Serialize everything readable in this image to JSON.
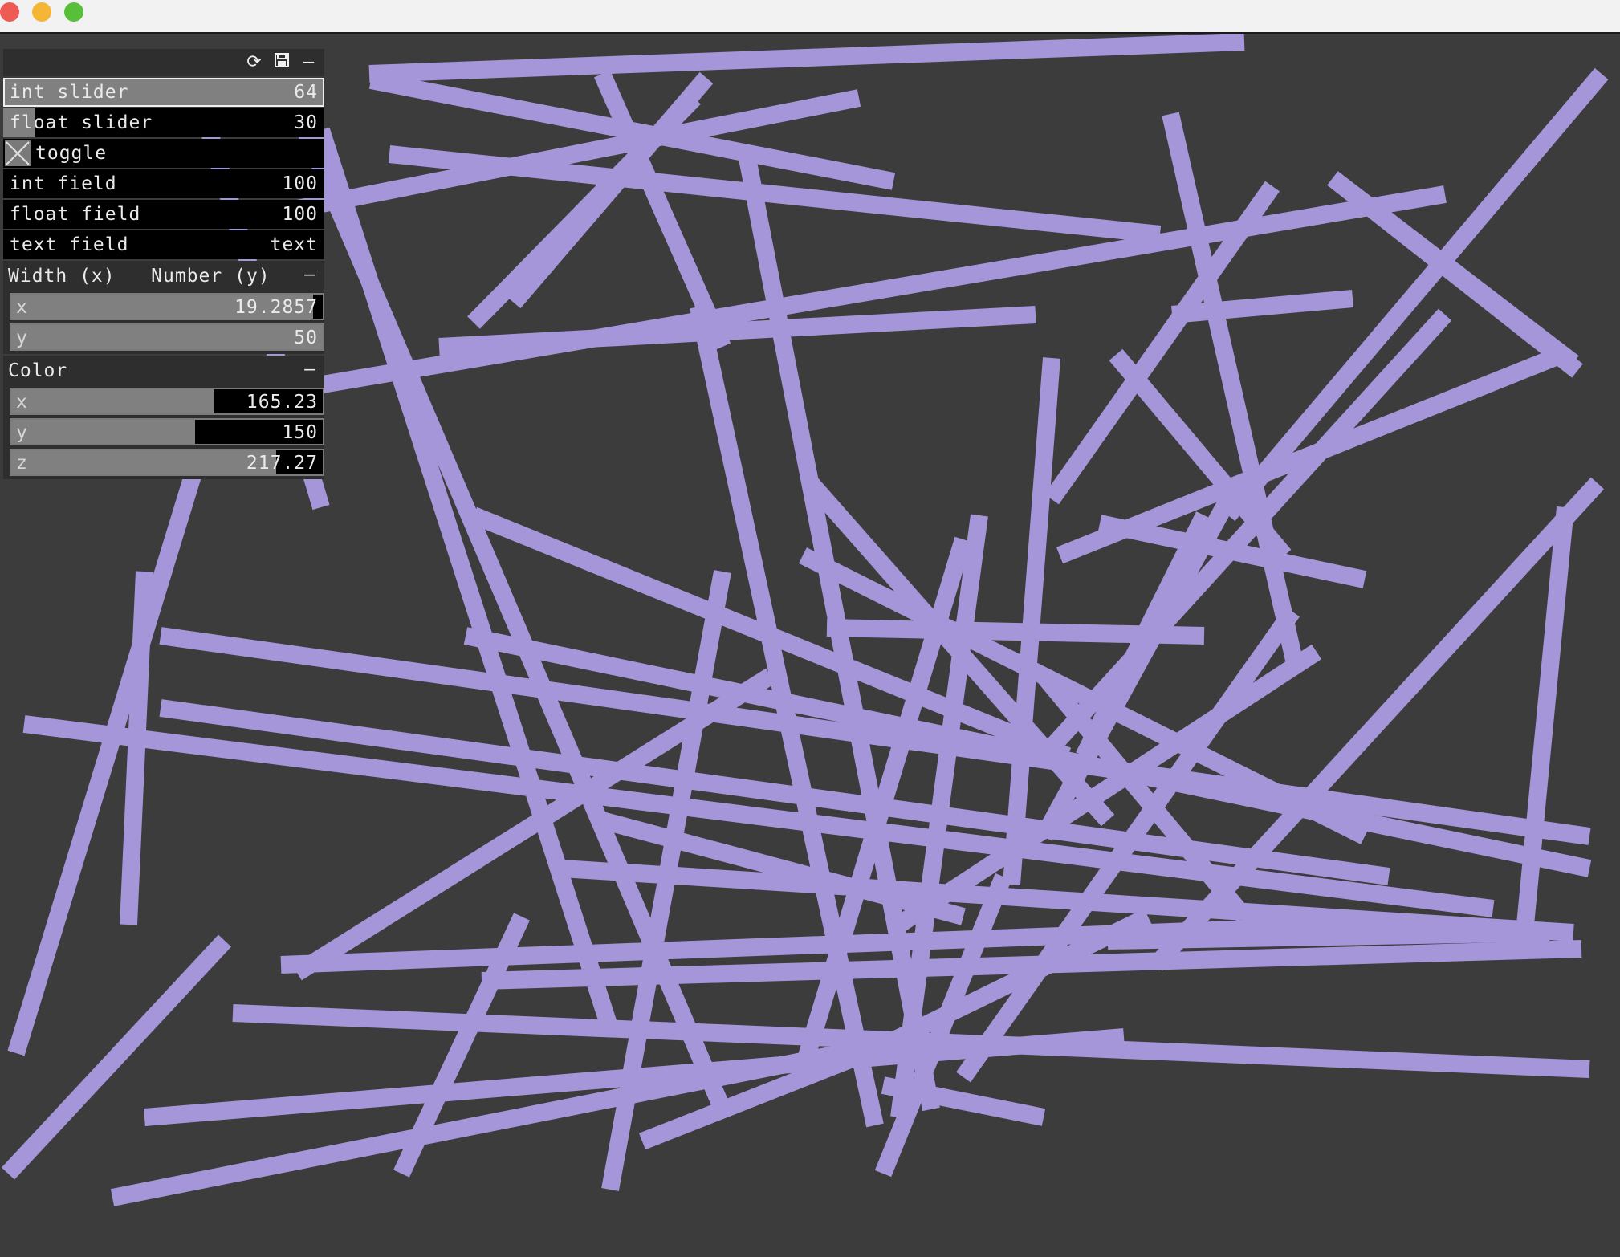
{
  "window": {
    "buttons": [
      "close",
      "minimize",
      "maximize"
    ]
  },
  "canvas": {
    "background": "#3c3c3c",
    "stroke_color": "#a496d9"
  },
  "panel": {
    "header_icons": [
      "refresh-icon",
      "save-icon",
      "minimize-icon"
    ],
    "minimize_glyph": "–",
    "int_slider": {
      "label": "int slider",
      "value": "64",
      "fraction": 1.0
    },
    "float_slider": {
      "label": "float slider",
      "value": "30",
      "fraction": 0.1
    },
    "toggle": {
      "label": "toggle",
      "checked": true
    },
    "int_field": {
      "label": "int field",
      "value": "100"
    },
    "float_field": {
      "label": "float field",
      "value": "100"
    },
    "text_field": {
      "label": "text field",
      "value": "text"
    },
    "width_group": {
      "title": "Width (x)   Number (y)",
      "x": {
        "label": "x",
        "value": "19.2857",
        "fraction": 0.97
      },
      "y": {
        "label": "y",
        "value": "50",
        "fraction": 1.0
      }
    },
    "color_group": {
      "title": "Color",
      "x": {
        "label": "x",
        "value": "165.23",
        "fraction": 0.65
      },
      "y": {
        "label": "y",
        "value": "150",
        "fraction": 0.59
      },
      "z": {
        "label": "z",
        "value": "217.27",
        "fraction": 0.85
      }
    }
  }
}
